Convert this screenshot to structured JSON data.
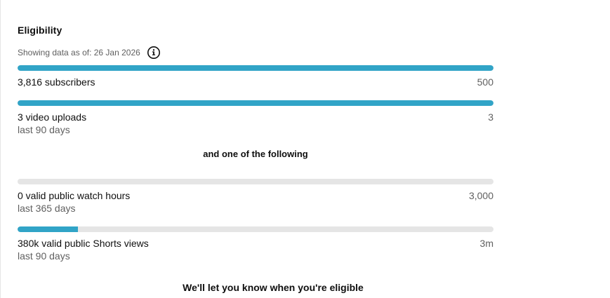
{
  "eligibility": {
    "title": "Eligibility",
    "as_of": "Showing data as of: 26 Jan 2026",
    "info_icon": "info-icon",
    "accent_color": "#31a4c7",
    "track_color": "#e5e5e5"
  },
  "requirements": [
    {
      "label": "3,816 subscribers",
      "sublabel": "",
      "target": "500",
      "progress": 1.0
    },
    {
      "label": "3 video uploads",
      "sublabel": "last 90 days",
      "target": "3",
      "progress": 1.0
    }
  ],
  "one_of_text": "and one of the following",
  "alternatives": [
    {
      "label": "0 valid public watch hours",
      "sublabel": "last 365 days",
      "target": "3,000",
      "progress": 0.0
    },
    {
      "label": "380k valid public Shorts views",
      "sublabel": "last 90 days",
      "target": "3m",
      "progress": 0.1267
    }
  ],
  "footer": "We'll let you know when you're eligible"
}
